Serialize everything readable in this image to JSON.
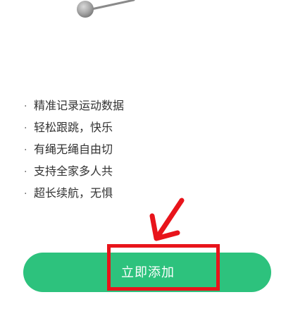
{
  "features": [
    {
      "bullet": "·",
      "text": "精准记录运动数据"
    },
    {
      "bullet": "·",
      "text": "轻松跟跳，快乐"
    },
    {
      "bullet": "·",
      "text": "有绳无绳自由切"
    },
    {
      "bullet": "·",
      "text": "支持全家多人共"
    },
    {
      "bullet": "·",
      "text": "超长续航，无惧"
    }
  ],
  "add_button": {
    "label": "立即添加"
  },
  "colors": {
    "button": "#2dc27d",
    "annotation": "#e8141b",
    "text": "#333333"
  },
  "icons": {
    "product": "jump-rope-handle-icon",
    "annotation": "red-arrow-icon"
  }
}
